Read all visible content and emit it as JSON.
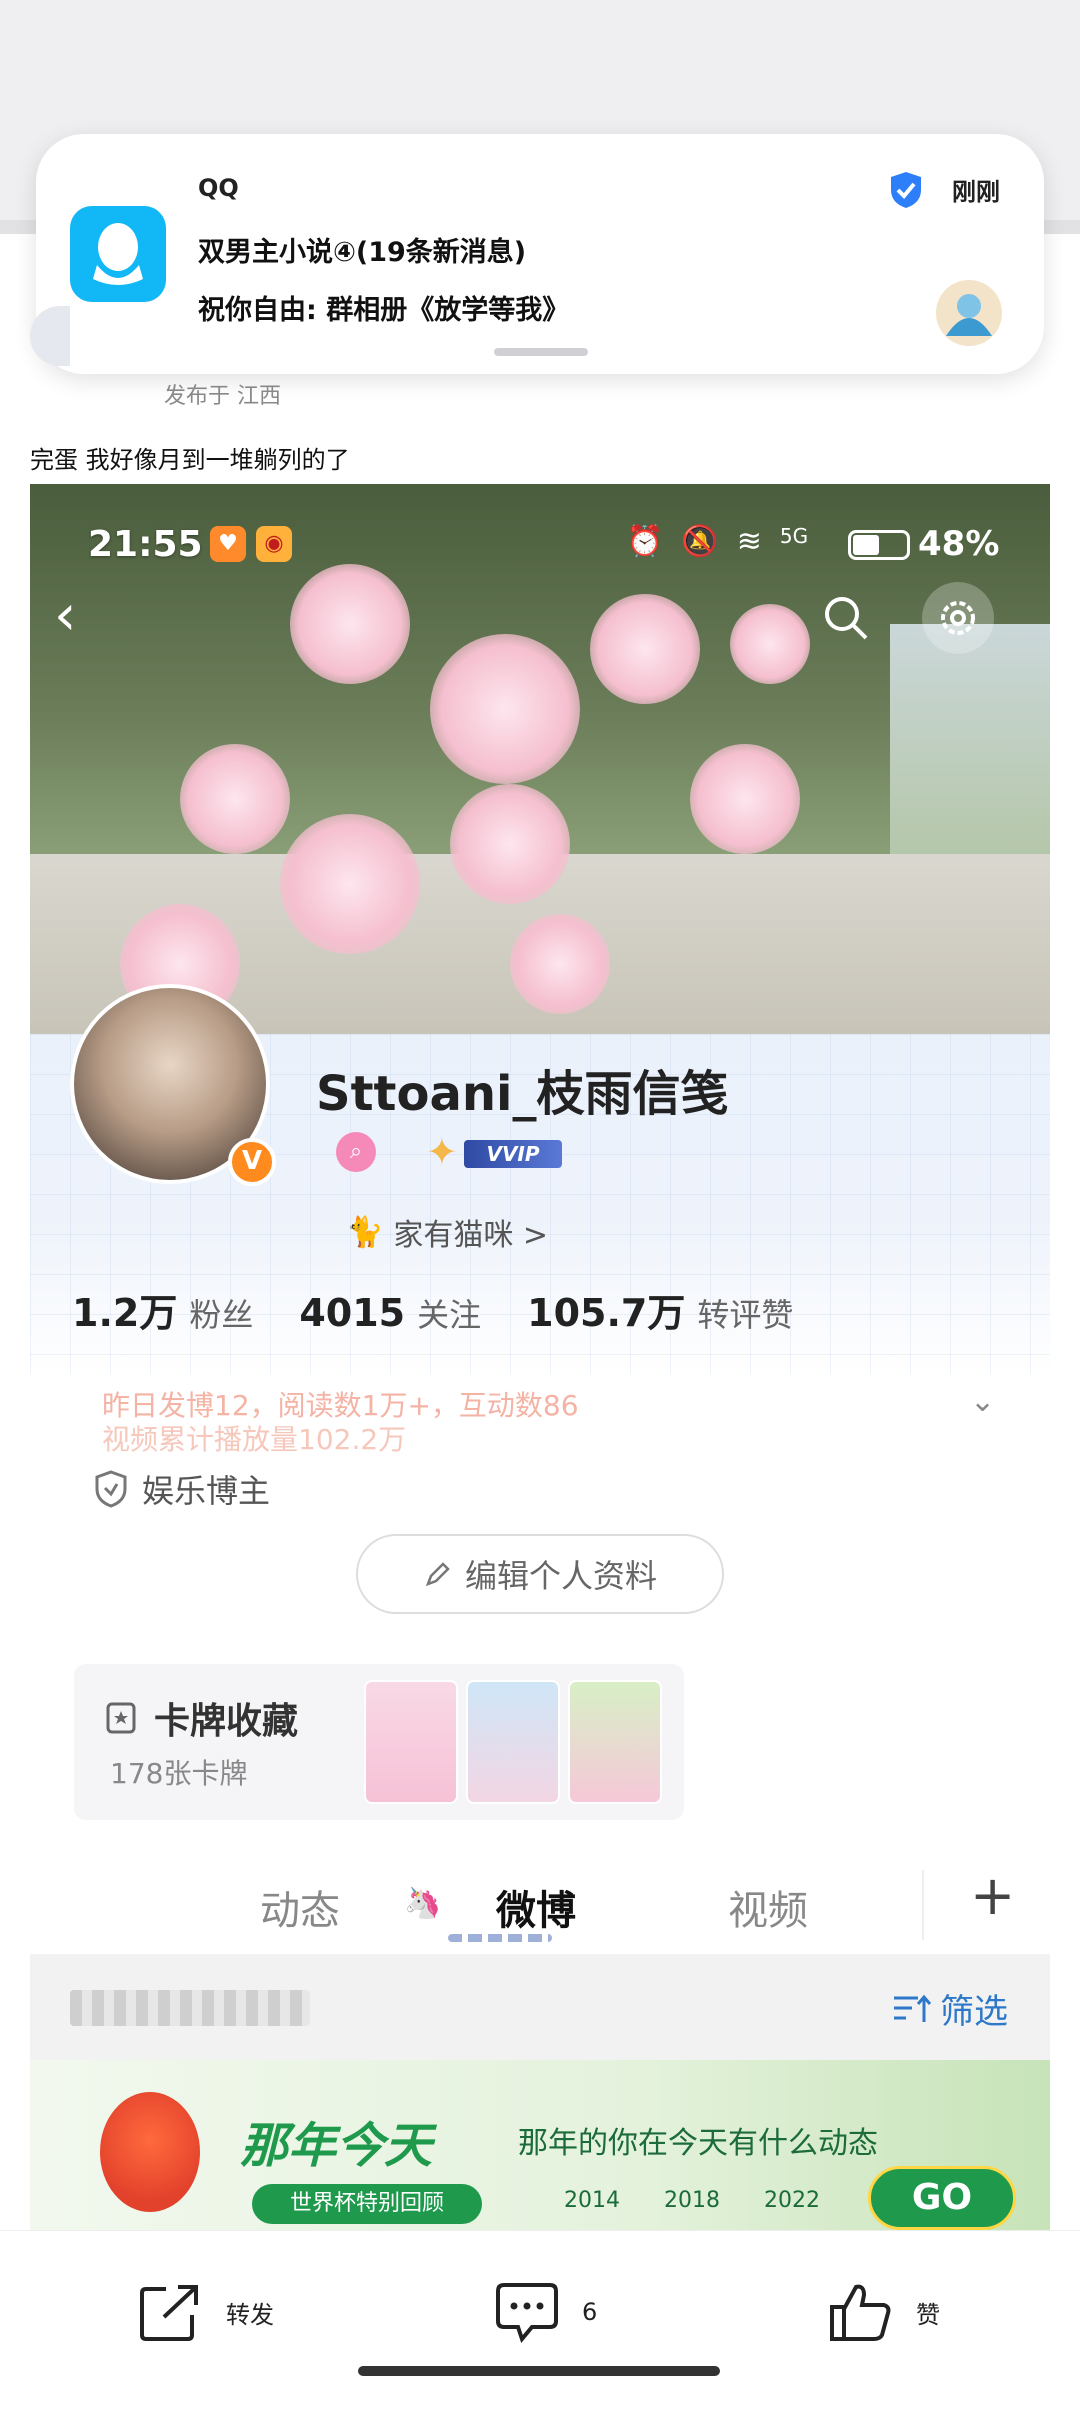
{
  "notification": {
    "app_name": "QQ",
    "title": "双男主小说④(19条新消息)",
    "body": "祝你自由: 群相册《放学等我》",
    "time": "刚刚"
  },
  "post": {
    "location": "发布于 江西",
    "text": "完蛋 我好像月到一堆躺列的了"
  },
  "screenshot": {
    "status_time": "21:55",
    "battery_percent": "48%",
    "network": "5G",
    "profile": {
      "username": "Sttoani_枝雨信笺",
      "vip_label": "VVIP",
      "tag": "家有猫咪 >",
      "stats": [
        {
          "number": "1.2万",
          "label": "粉丝"
        },
        {
          "number": "4015",
          "label": "关注"
        },
        {
          "number": "105.7万",
          "label": "转评赞"
        }
      ],
      "summary_line1": "昨日发博12，阅读数1万+，互动数86",
      "summary_line2": "视频累计播放量102.2万",
      "role": "娱乐博主",
      "edit_button": "编辑个人资料"
    },
    "card_collection": {
      "title": "卡牌收藏",
      "count": "178张卡牌"
    },
    "tabs": [
      {
        "label": "动态",
        "active": false
      },
      {
        "label": "微博",
        "active": true
      },
      {
        "label": "视频",
        "active": false
      }
    ],
    "filter_label": "筛选",
    "banner": {
      "title": "那年今天",
      "subtitle": "那年的你在今天有什么动态",
      "pill": "世界杯特别回顾",
      "years": [
        "2014",
        "2018",
        "2022"
      ],
      "go": "GO"
    }
  },
  "actions": {
    "repost": "转发",
    "comment_count": "6",
    "like": "赞"
  },
  "colors": {
    "qq_blue": "#12b7f5",
    "filter_blue": "#2d78c9",
    "banner_green": "#1f9a4d",
    "vip_orange": "#ff8b1f"
  }
}
